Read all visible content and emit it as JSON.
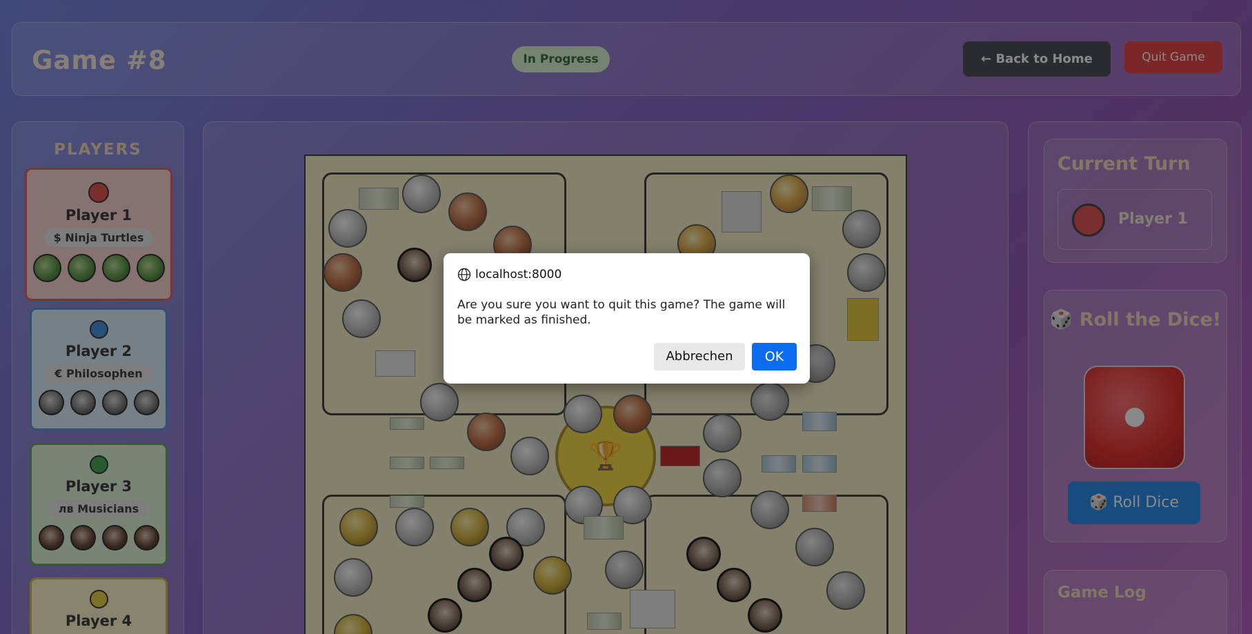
{
  "header": {
    "title": "Game #8",
    "status": "In Progress",
    "back_label": "← Back to Home",
    "quit_label": "Quit Game"
  },
  "players_panel": {
    "title": "PLAYERS",
    "players": [
      {
        "name": "Player 1",
        "team": "$ Ninja Turtles",
        "color": "#e24848"
      },
      {
        "name": "Player 2",
        "team": "€ Philosophen",
        "color": "#3d8be0"
      },
      {
        "name": "Player 3",
        "team": "лв Musicians",
        "color": "#3fa24a"
      },
      {
        "name": "Player 4",
        "team": "",
        "color": "#e2cc3b"
      }
    ]
  },
  "board": {
    "center_icon": "🏆"
  },
  "current_turn": {
    "title": "Current Turn",
    "player": "Player 1",
    "color": "#e24848"
  },
  "dice": {
    "title": "🎲 Roll the Dice!",
    "value": 1,
    "button_label": "🎲 Roll Dice"
  },
  "game_log": {
    "title": "Game Log"
  },
  "dialog": {
    "origin": "localhost:8000",
    "message": "Are you sure you want to quit this game? The game will be marked as finished.",
    "cancel_label": "Abbrechen",
    "ok_label": "OK"
  }
}
